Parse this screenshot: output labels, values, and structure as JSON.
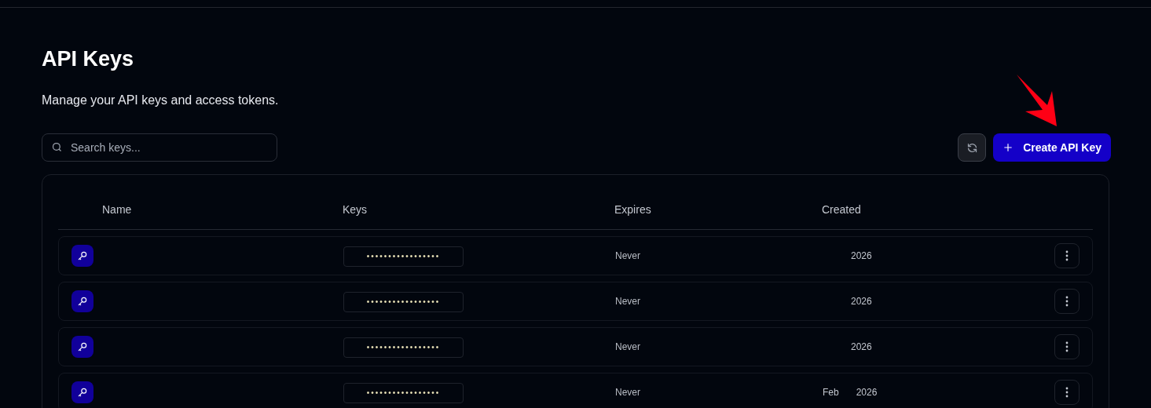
{
  "header": {
    "title": "API Keys",
    "subtitle": "Manage your API keys and access tokens."
  },
  "search": {
    "placeholder": "Search keys..."
  },
  "create_button": {
    "label": "Create API Key"
  },
  "table": {
    "columns": [
      "Name",
      "Keys",
      "Expires",
      "Created"
    ],
    "rows": [
      {
        "key": "•••••••••••••••••",
        "expires": "Never",
        "created": [
          "2026"
        ]
      },
      {
        "key": "•••••••••••••••••",
        "expires": "Never",
        "created": [
          "2026"
        ]
      },
      {
        "key": "•••••••••••••••••",
        "expires": "Never",
        "created": [
          "2026"
        ]
      },
      {
        "key": "•••••••••••••••••",
        "expires": "Never",
        "created": [
          "Feb",
          "2026"
        ]
      }
    ]
  }
}
